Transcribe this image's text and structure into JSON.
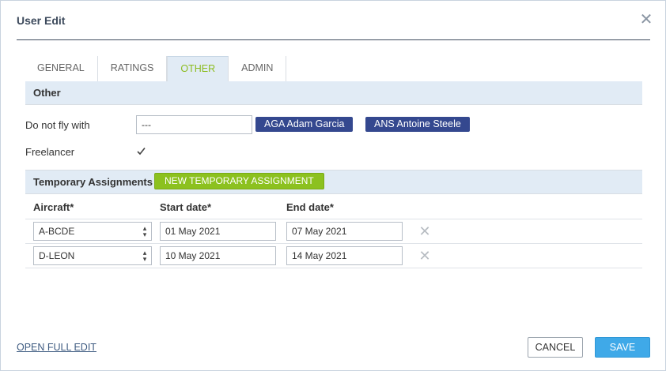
{
  "dialog": {
    "title": "User Edit",
    "close_icon": "close-icon"
  },
  "tabs": [
    {
      "label": "GENERAL",
      "active": false
    },
    {
      "label": "RATINGS",
      "active": false
    },
    {
      "label": "OTHER",
      "active": true
    },
    {
      "label": "ADMIN",
      "active": false
    }
  ],
  "other_section": {
    "heading": "Other",
    "do_not_fly_label": "Do not fly with",
    "do_not_fly_input_value": "---",
    "do_not_fly_tags": [
      "AGA Adam Garcia",
      "ANS Antoine Steele"
    ],
    "freelancer_label": "Freelancer",
    "freelancer_checked": true
  },
  "temporary_section": {
    "heading": "Temporary Assignments",
    "new_button_label": "NEW TEMPORARY ASSIGNMENT",
    "columns": [
      "Aircraft*",
      "Start date*",
      "End date*"
    ],
    "rows": [
      {
        "aircraft": "A-BCDE",
        "start_date": "01 May 2021",
        "end_date": "07 May 2021"
      },
      {
        "aircraft": "D-LEON",
        "start_date": "10 May 2021",
        "end_date": "14 May 2021"
      }
    ]
  },
  "footer": {
    "open_full_edit": "OPEN FULL EDIT",
    "cancel": "CANCEL",
    "save": "SAVE"
  },
  "colors": {
    "accent_green": "#8cc11f",
    "tag_blue": "#34488f",
    "save_blue": "#3fa9e8",
    "section_bg": "#e1ebf5"
  }
}
